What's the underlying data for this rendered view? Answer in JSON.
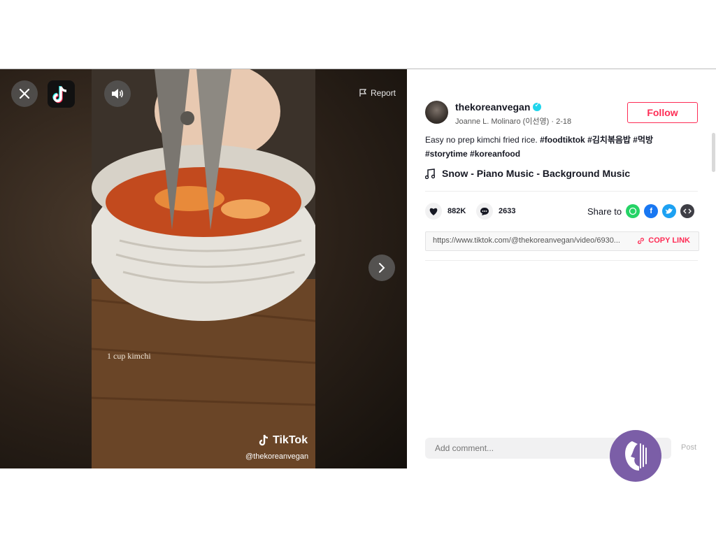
{
  "player": {
    "report_label": "Report",
    "video_caption": "1 cup kimchi",
    "watermark_brand": "TikTok",
    "watermark_user": "@thekoreanvegan"
  },
  "author": {
    "username": "thekoreanvegan",
    "nickname_date": "Joanne L. Molinaro (이선영) · 2-18",
    "follow_label": "Follow"
  },
  "description": {
    "text": "Easy no prep kimchi fried rice. ",
    "tags": [
      "#foodtiktok",
      "#김치볶음밥",
      "#먹방",
      "#storytime",
      "#koreanfood"
    ]
  },
  "music": {
    "title": "Snow - Piano Music - Background Music"
  },
  "stats": {
    "likes": "882K",
    "comments": "2633"
  },
  "share": {
    "label": "Share to",
    "icons": [
      "whatsapp-icon",
      "facebook-icon",
      "twitter-icon",
      "embed-icon"
    ]
  },
  "link": {
    "url": "https://www.tiktok.com/@thekoreanvegan/video/6930...",
    "copy_label": "COPY LINK"
  },
  "comment": {
    "placeholder": "Add comment...",
    "post_label": "Post"
  },
  "colors": {
    "accent": "#fe2c55",
    "verified": "#20d5ec",
    "assistant": "#7b5ea7"
  }
}
